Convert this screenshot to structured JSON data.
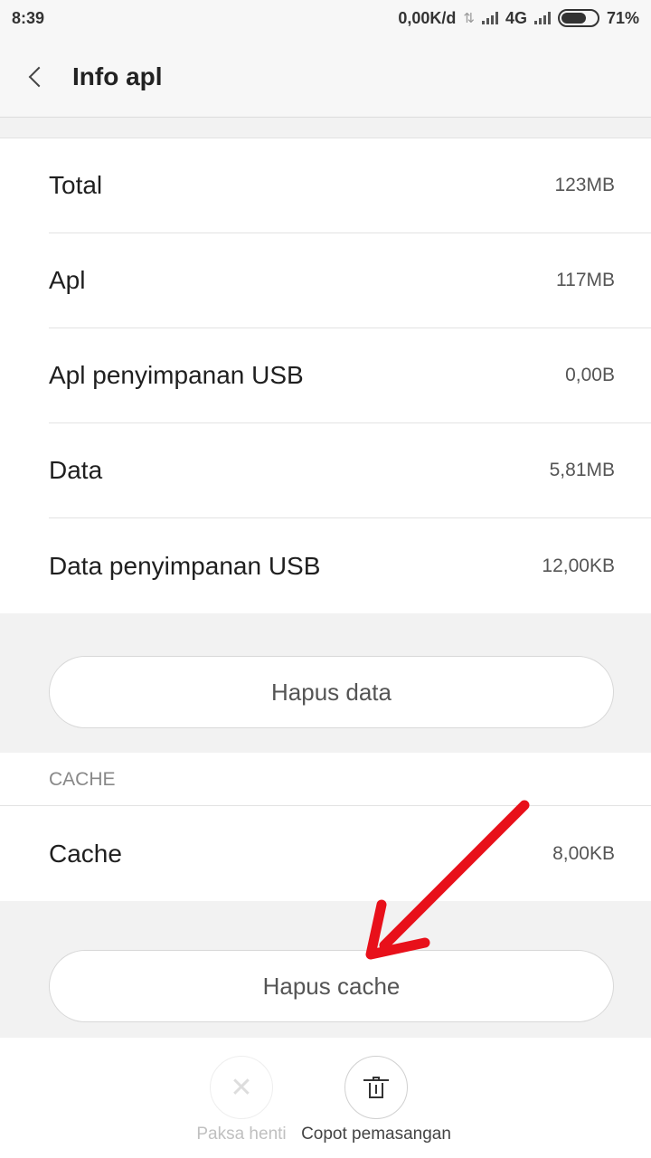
{
  "status": {
    "time": "8:39",
    "speed": "0,00K/d",
    "network": "4G",
    "battery": "71%",
    "battery_level": 0.71
  },
  "header": {
    "title": "Info apl"
  },
  "storage": {
    "rows": [
      {
        "label": "Total",
        "value": "123MB"
      },
      {
        "label": "Apl",
        "value": "117MB"
      },
      {
        "label": "Apl penyimpanan USB",
        "value": "0,00B"
      },
      {
        "label": "Data",
        "value": "5,81MB"
      },
      {
        "label": "Data penyimpanan USB",
        "value": "12,00KB"
      }
    ],
    "clear_data_label": "Hapus data"
  },
  "cache": {
    "section_label": "CACHE",
    "row": {
      "label": "Cache",
      "value": "8,00KB"
    },
    "clear_cache_label": "Hapus cache"
  },
  "actions": {
    "force_stop_label": "Paksa henti",
    "uninstall_label": "Copot pemasangan"
  },
  "colors": {
    "annotation_arrow": "#e8101a"
  }
}
